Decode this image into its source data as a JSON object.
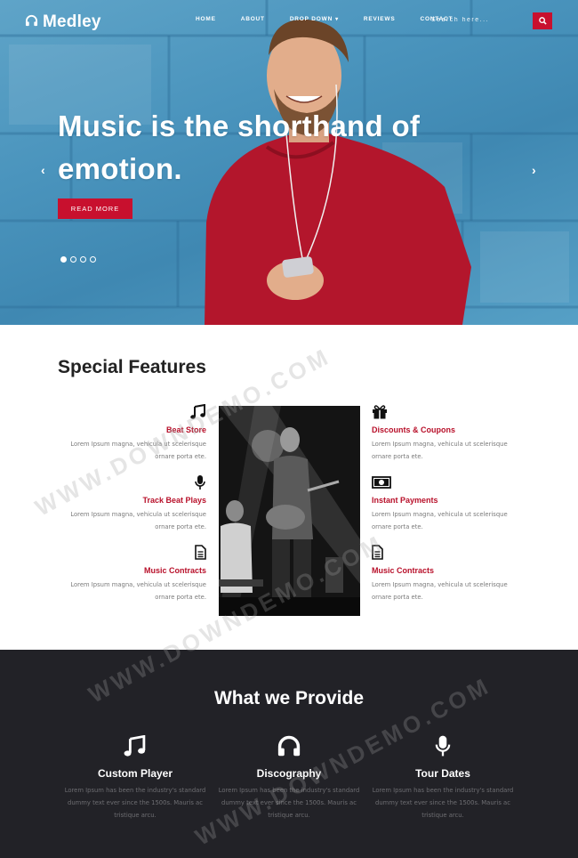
{
  "brand": {
    "name": "Medley"
  },
  "nav": {
    "links": [
      "HOME",
      "ABOUT",
      "DROP DOWN",
      "REVIEWS",
      "CONTACT"
    ],
    "search_placeholder": "Search here..."
  },
  "hero": {
    "title": "Music is the shorthand of emotion.",
    "button": "READ MORE",
    "slides": 4,
    "active_slide": 1
  },
  "features": {
    "title": "Special Features",
    "left": [
      {
        "icon": "music-note-icon",
        "name": "Beat Store",
        "desc": "Lorem Ipsum magna, vehicula ut scelerisque ornare porta ete."
      },
      {
        "icon": "microphone-icon",
        "name": "Track Beat Plays",
        "desc": "Lorem Ipsum magna, vehicula ut scelerisque ornare porta ete."
      },
      {
        "icon": "document-icon",
        "name": "Music Contracts",
        "desc": "Lorem Ipsum magna, vehicula ut scelerisque ornare porta ete."
      }
    ],
    "right": [
      {
        "icon": "gift-icon",
        "name": "Discounts & Coupons",
        "desc": "Lorem Ipsum magna, vehicula ut scelerisque ornare porta ete."
      },
      {
        "icon": "money-icon",
        "name": "Instant Payments",
        "desc": "Lorem Ipsum magna, vehicula ut scelerisque ornare porta ete."
      },
      {
        "icon": "document-icon",
        "name": "Music Contracts",
        "desc": "Lorem Ipsum magna, vehicula ut scelerisque ornare porta ete."
      }
    ]
  },
  "provide": {
    "title": "What we Provide",
    "items": [
      {
        "icon": "music-note-icon",
        "name": "Custom Player",
        "desc": "Lorem Ipsum has been the industry's standard dummy text ever since the 1500s. Mauris ac tristique arcu."
      },
      {
        "icon": "headphones-icon",
        "name": "Discography",
        "desc": "Lorem Ipsum has been the industry's standard dummy text ever since the 1500s. Mauris ac tristique arcu."
      },
      {
        "icon": "microphone-icon",
        "name": "Tour Dates",
        "desc": "Lorem Ipsum has been the industry's standard dummy text ever since the 1500s. Mauris ac tristique arcu."
      }
    ]
  },
  "watermark": "WWW.DOWNDEMO.COM",
  "colors": {
    "accent": "#c8102e",
    "dark": "#222227",
    "hero_blue": "#4a94bd"
  }
}
